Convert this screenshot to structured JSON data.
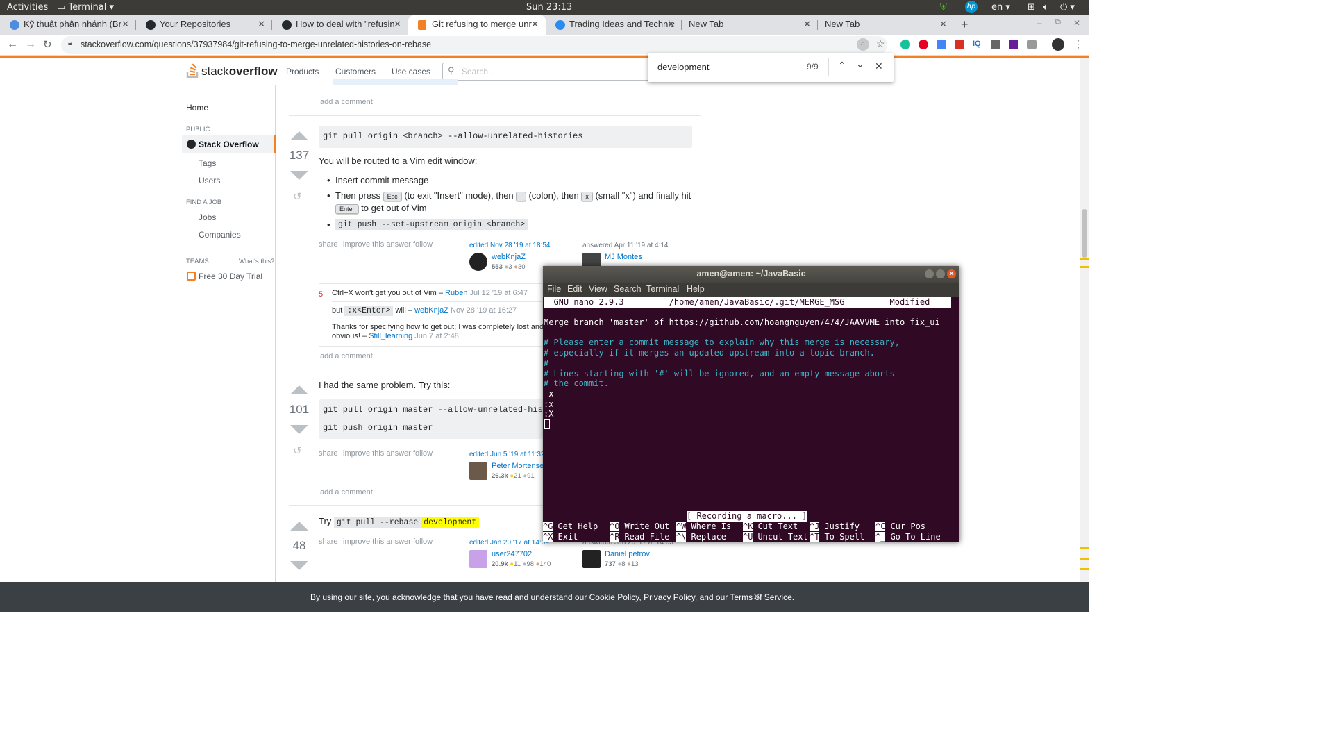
{
  "topbar": {
    "activities": "Activities",
    "app": "Terminal",
    "clock": "Sun 23:13",
    "lang": "en"
  },
  "tabs": [
    {
      "label": "Kỹ thuật phân nhánh (Br",
      "color": "#4e8cde"
    },
    {
      "label": "Your Repositories",
      "color": "#24292e"
    },
    {
      "label": "How to deal with \"refusin",
      "color": "#24292e"
    },
    {
      "label": "Git refusing to merge unr",
      "color": "#f48024"
    },
    {
      "label": "Trading Ideas and Technic",
      "color": "#2a8cf0"
    },
    {
      "label": "New Tab",
      "color": ""
    },
    {
      "label": "New Tab",
      "color": ""
    }
  ],
  "address": {
    "url": "stackoverflow.com/questions/37937984/git-refusing-to-merge-unrelated-histories-on-rebase"
  },
  "so_header": {
    "logo_a": "stack",
    "logo_b": "overflow",
    "nav": [
      "Products",
      "Customers",
      "Use cases"
    ],
    "search_placeholder": "Search..."
  },
  "findbar": {
    "query": "development",
    "count": "9/9"
  },
  "sidebar": {
    "home": "Home",
    "public": "PUBLIC",
    "so": "Stack Overflow",
    "tags": "Tags",
    "users": "Users",
    "find_job": "FIND A JOB",
    "jobs": "Jobs",
    "companies": "Companies",
    "teams": "TEAMS",
    "whats_this": "What's this?",
    "trial": "Free 30 Day Trial"
  },
  "top_add_comment": "add a comment",
  "answer1": {
    "votes": "137",
    "code1": "git pull origin <branch> --allow-unrelated-histories",
    "routed": "You will be routed to a Vim edit window:",
    "li1": "Insert commit message",
    "li2_a": "Then press",
    "kbd_esc": "Esc",
    "li2_b": "(to exit \"Insert\" mode), then",
    "kbd_colon": ":",
    "li2_c": "(colon), then",
    "kbd_x": "x",
    "li2_d": "(small \"x\") and finally hit",
    "kbd_enter": "Enter",
    "li2_e": "to get out of Vim",
    "li3": "git push --set-upstream origin <branch>",
    "actions": [
      "share",
      "improve this answer",
      "follow"
    ],
    "edited": "edited Nov 28 '19 at 18:54",
    "editor": "webKnjaZ",
    "editor_rep": "553",
    "editor_badges": [
      "3",
      "30"
    ],
    "answered": "answered Apr 11 '19 at 4:14",
    "author": "MJ Montes",
    "comments": [
      {
        "score": "5",
        "text": "Ctrl+X won't get you out of Vim –",
        "user": "Ruben",
        "date": "Jul 12 '19 at 6:47"
      },
      {
        "score": "",
        "pre": "but",
        "code": ":x<Enter>",
        "text": "will –",
        "user": "webKnjaZ",
        "date": "Nov 28 '19 at 16:27"
      },
      {
        "score": "",
        "text": "Thanks for specifying how to get out; I was completely lost and a",
        "text2": "obvious! –",
        "user": "Still_learning",
        "date": "Jun 7 at 2:48"
      }
    ],
    "add_comment": "add a comment"
  },
  "answer2": {
    "votes": "101",
    "intro": "I had the same problem. Try this:",
    "code1": "git pull origin master --allow-unrelated-histories",
    "code2": "git push origin master",
    "actions": [
      "share",
      "improve this answer",
      "follow"
    ],
    "edited": "edited Jun 5 '19 at 11:32",
    "editor": "Peter Mortensen",
    "editor_rep": "26.3k",
    "editor_badges": [
      "21",
      "91"
    ],
    "add_comment": "add a comment"
  },
  "answer3": {
    "votes": "48",
    "pre": "Try",
    "code": "git pull --rebase",
    "highlight": "development",
    "actions": [
      "share",
      "improve this answer",
      "follow"
    ],
    "edited": "edited Jan 20 '17 at 14:09",
    "editor": "user247702",
    "editor_rep": "20.9k",
    "editor_badges": [
      "11",
      "98",
      "140"
    ],
    "answered": "answered Jan 20 '17 at 14:03",
    "author": "Daniel petrov",
    "author_rep": "737",
    "author_badges": [
      "8",
      "13"
    ]
  },
  "terminal": {
    "title": "amen@amen: ~/JavaBasic",
    "menu": [
      "File",
      "Edit",
      "View",
      "Search",
      "Terminal",
      "Help"
    ],
    "nano_header": "  GNU nano 2.9.3         /home/amen/JavaBasic/.git/MERGE_MSG         Modified  ",
    "line1": "Merge branch 'master' of https://github.com/hoangnguyen7474/JAAVVME into fix_ui",
    "c1": "# Please enter a commit message to explain why this merge is necessary,",
    "c2": "# especially if it merges an updated upstream into a topic branch.",
    "c3": "#",
    "c4": "# Lines starting with '#' will be ignored, and an empty message aborts",
    "c5": "# the commit.",
    "x1": " x",
    "x2": ":x",
    "x3": ":X",
    "status": "[ Recording a macro... ]",
    "sc_row1": [
      [
        "^G",
        "Get Help"
      ],
      [
        "^O",
        "Write Out"
      ],
      [
        "^W",
        "Where Is"
      ],
      [
        "^K",
        "Cut Text"
      ],
      [
        "^J",
        "Justify"
      ],
      [
        "^C",
        "Cur Pos"
      ]
    ],
    "sc_row2": [
      [
        "^X",
        "Exit"
      ],
      [
        "^R",
        "Read File"
      ],
      [
        "^\\",
        "Replace"
      ],
      [
        "^U",
        "Uncut Text"
      ],
      [
        "^T",
        "To Spell"
      ],
      [
        "^_",
        "Go To Line"
      ]
    ]
  },
  "cookie": {
    "pre": "By using our site, you acknowledge that you have read and understand our",
    "cookie_policy": "Cookie Policy",
    "comma": ",",
    "privacy": "Privacy Policy",
    "and": ", and our",
    "terms": "Terms of Service",
    "dot": "."
  }
}
